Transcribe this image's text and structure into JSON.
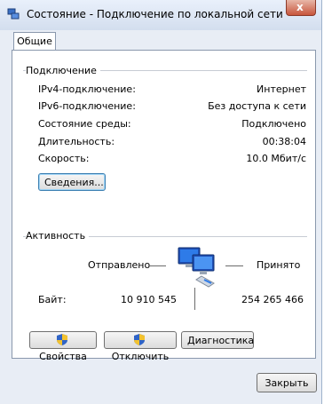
{
  "window": {
    "title": "Состояние - Подключение по локальной сети",
    "close_glyph": "x"
  },
  "tabs": [
    {
      "label": "Общие"
    }
  ],
  "connection": {
    "group_title": "Подключение",
    "rows": [
      {
        "label": "IPv4-подключение:",
        "value": "Интернет"
      },
      {
        "label": "IPv6-подключение:",
        "value": "Без доступа к сети"
      },
      {
        "label": "Состояние среды:",
        "value": "Подключено"
      },
      {
        "label": "Длительность:",
        "value": "00:38:04"
      },
      {
        "label": "Скорость:",
        "value": "10.0 Мбит/с"
      }
    ],
    "details_button": "Сведения..."
  },
  "activity": {
    "group_title": "Активность",
    "sent_label": "Отправлено",
    "received_label": "Принято",
    "bytes_label": "Байт:",
    "bytes_sent": "10 910 545",
    "bytes_received": "254 265 466"
  },
  "buttons": {
    "properties": "Свойства",
    "disable": "Отключить",
    "diagnose": "Диагностика",
    "close": "Закрыть"
  },
  "icons": {
    "title": "network-icon",
    "activity": "network-computers-icon",
    "shield": "uac-shield-icon"
  }
}
